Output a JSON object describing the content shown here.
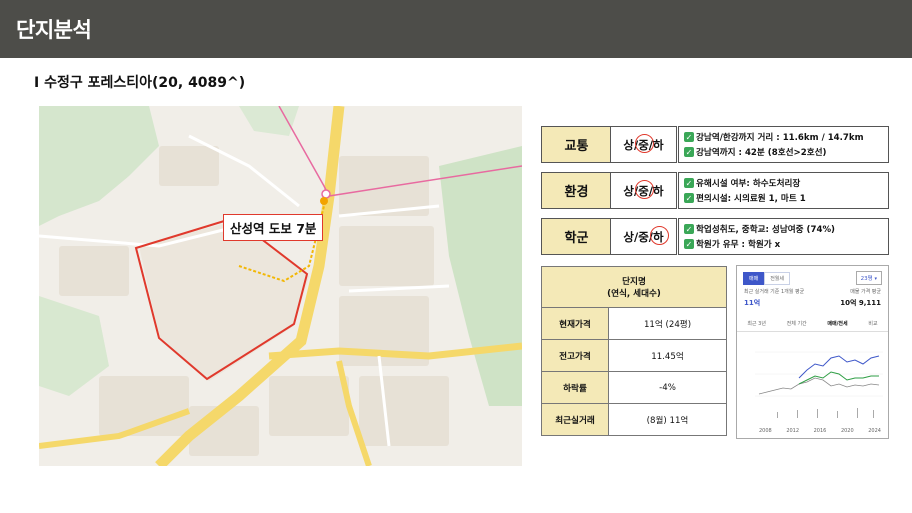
{
  "header": {
    "title": "단지분석"
  },
  "subtitle": "I 수정구 포레스티아(20, 4089^)",
  "map": {
    "callout": "산성역 도보 7분"
  },
  "categories": [
    {
      "label": "교통",
      "grades": [
        "상",
        "중",
        "하"
      ],
      "selected": "중",
      "lines": [
        "강남역/한강까지 거리 : 11.6km / 14.7km",
        "강남역까지 : 42분 (8호선>2호선)"
      ]
    },
    {
      "label": "환경",
      "grades": [
        "상",
        "중",
        "하"
      ],
      "selected": "중",
      "lines": [
        "유해시설 여부: 하수도처리장",
        "편의시설: 시의료원 1, 마트 1"
      ]
    },
    {
      "label": "학군",
      "grades": [
        "상",
        "중",
        "하"
      ],
      "selected": "하",
      "lines": [
        "학업성취도, 중학교: 성남여중 (74%)",
        "학원가 유무 : 학원가 x"
      ]
    }
  ],
  "price_table": {
    "header_line1": "단지명",
    "header_line2": "(연식, 세대수)",
    "rows": [
      {
        "label": "현재가격",
        "value": "11억 (24평)"
      },
      {
        "label": "전고가격",
        "value": "11.45억"
      },
      {
        "label": "하락률",
        "value": "-4%"
      },
      {
        "label": "최근실거래",
        "value": "(8월) 11억"
      }
    ]
  },
  "chart_card": {
    "seg_on": "매매",
    "seg_off": "전월세",
    "select": "23평",
    "label_left": "최근 실거래 기준 1개월 평균",
    "label_right": "매물 가격 평균",
    "value_left": "11억",
    "value_right": "10억 9,111",
    "tabs": [
      "최근 3년",
      "전체 기간",
      "매매/전세",
      "비교"
    ],
    "active_tab": "매매/전세",
    "years": [
      "2008",
      "2012",
      "2016",
      "2020",
      "2024"
    ],
    "colors": {
      "sale": "#3e57c9",
      "jeonse": "#2e9e44",
      "volume": "#888888"
    }
  }
}
